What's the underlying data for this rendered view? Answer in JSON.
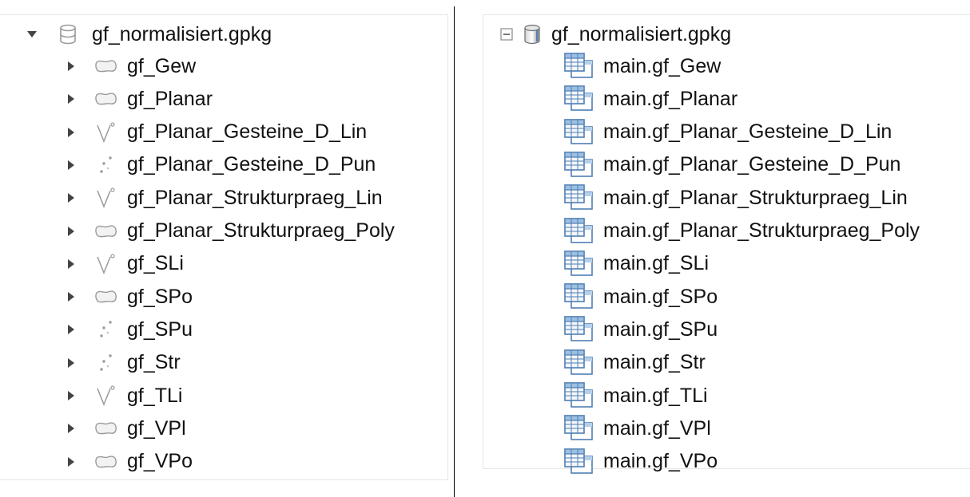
{
  "left_tree": {
    "root": {
      "label": "gf_normalisiert.gpkg",
      "icon": "database-icon",
      "expanded": true
    },
    "items": [
      {
        "label": "gf_Gew",
        "geometry": "polygon"
      },
      {
        "label": "gf_Planar",
        "geometry": "polygon"
      },
      {
        "label": "gf_Planar_Gesteine_D_Lin",
        "geometry": "line"
      },
      {
        "label": "gf_Planar_Gesteine_D_Pun",
        "geometry": "point"
      },
      {
        "label": "gf_Planar_Strukturpraeg_Lin",
        "geometry": "line"
      },
      {
        "label": "gf_Planar_Strukturpraeg_Poly",
        "geometry": "polygon"
      },
      {
        "label": "gf_SLi",
        "geometry": "line"
      },
      {
        "label": "gf_SPo",
        "geometry": "polygon"
      },
      {
        "label": "gf_SPu",
        "geometry": "point"
      },
      {
        "label": "gf_Str",
        "geometry": "point"
      },
      {
        "label": "gf_TLi",
        "geometry": "line"
      },
      {
        "label": "gf_VPl",
        "geometry": "polygon"
      },
      {
        "label": "gf_VPo",
        "geometry": "polygon"
      }
    ]
  },
  "right_tree": {
    "root": {
      "label": "gf_normalisiert.gpkg",
      "icon": "database-cylinder-icon",
      "expanded": true
    },
    "items": [
      {
        "label": "main.gf_Gew"
      },
      {
        "label": "main.gf_Planar"
      },
      {
        "label": "main.gf_Planar_Gesteine_D_Lin"
      },
      {
        "label": "main.gf_Planar_Gesteine_D_Pun"
      },
      {
        "label": "main.gf_Planar_Strukturpraeg_Lin"
      },
      {
        "label": "main.gf_Planar_Strukturpraeg_Poly"
      },
      {
        "label": "main.gf_SLi"
      },
      {
        "label": "main.gf_SPo"
      },
      {
        "label": "main.gf_SPu"
      },
      {
        "label": "main.gf_Str"
      },
      {
        "label": "main.gf_TLi"
      },
      {
        "label": "main.gf_VPl"
      },
      {
        "label": "main.gf_VPo"
      }
    ]
  },
  "colors": {
    "icon_gray": "#9a9a9a",
    "table_blue": "#4f7fb3",
    "text": "#111111"
  }
}
